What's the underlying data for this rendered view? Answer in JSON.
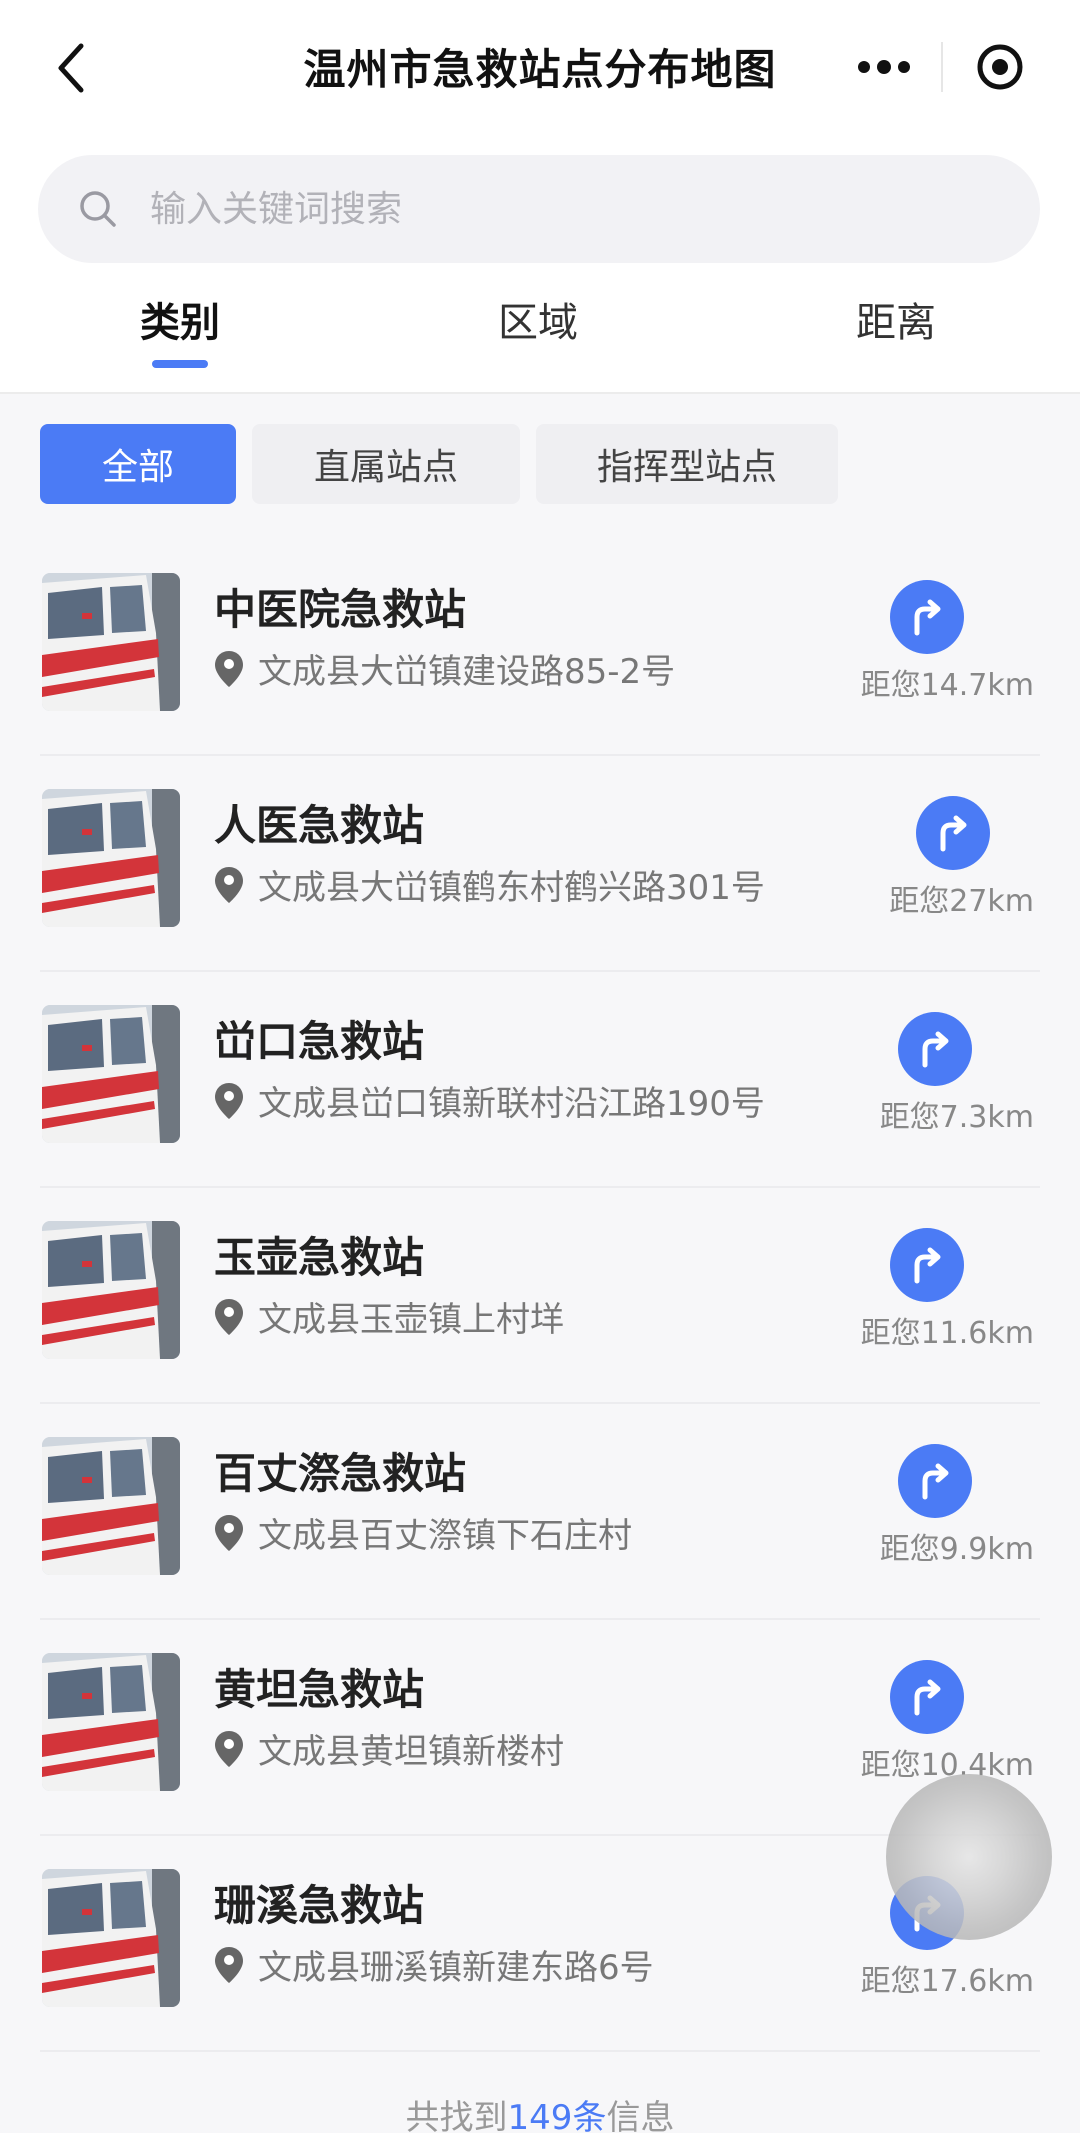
{
  "navbar": {
    "title": "温州市急救站点分布地图"
  },
  "search": {
    "placeholder": "输入关键词搜索"
  },
  "tabs": [
    {
      "label": "类别",
      "active": true
    },
    {
      "label": "区域",
      "active": false
    },
    {
      "label": "距离",
      "active": false
    }
  ],
  "filters": [
    {
      "label": "全部",
      "active": true
    },
    {
      "label": "直属站点",
      "active": false
    },
    {
      "label": "指挥型站点",
      "active": false
    }
  ],
  "stations": [
    {
      "name": "中医院急救站",
      "address": "文成县大峃镇建设路85-2号",
      "distance": "距您14.7km"
    },
    {
      "name": "人医急救站",
      "address": "文成县大峃镇鹤东村鹤兴路301号",
      "distance": "距您27km"
    },
    {
      "name": "峃口急救站",
      "address": "文成县峃口镇新联村沿江路190号",
      "distance": "距您7.3km"
    },
    {
      "name": "玉壶急救站",
      "address": "文成县玉壶镇上村垟",
      "distance": "距您11.6km"
    },
    {
      "name": "百丈漈急救站",
      "address": "文成县百丈漈镇下石庄村",
      "distance": "距您9.9km"
    },
    {
      "name": "黄坦急救站",
      "address": "文成县黄坦镇新楼村",
      "distance": "距您10.4km"
    },
    {
      "name": "珊溪急救站",
      "address": "文成县珊溪镇新建东路6号",
      "distance": "距您17.6km"
    }
  ],
  "footer": {
    "prefix": "共找到",
    "count": "149条",
    "suffix": "信息"
  },
  "colors": {
    "accent": "#4b7bf5",
    "text": "#222222",
    "muted": "#777777"
  }
}
